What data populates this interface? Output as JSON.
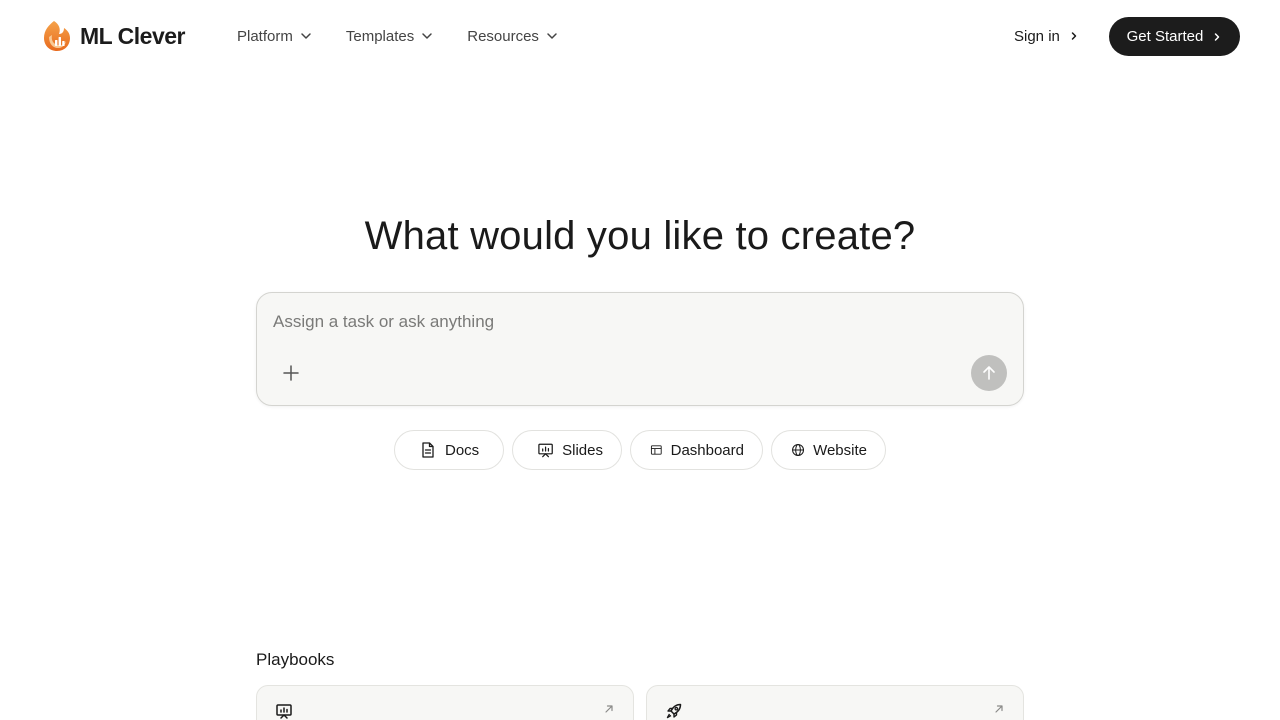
{
  "brand": {
    "name": "ML Clever",
    "logo_icon": "flame-chart-logo-icon",
    "accent": "#f08a2c"
  },
  "nav": {
    "items": [
      {
        "label": "Platform",
        "icon": "chevron-down-icon"
      },
      {
        "label": "Templates",
        "icon": "chevron-down-icon"
      },
      {
        "label": "Resources",
        "icon": "chevron-down-icon"
      }
    ],
    "sign_in_label": "Sign in",
    "get_started_label": "Get Started"
  },
  "hero": {
    "title": "What would you like to create?",
    "input_placeholder": "Assign a task or ask anything",
    "input_value": ""
  },
  "chips": [
    {
      "label": "Docs",
      "icon": "document-icon"
    },
    {
      "label": "Slides",
      "icon": "presentation-icon"
    },
    {
      "label": "Dashboard",
      "icon": "dashboard-icon"
    },
    {
      "label": "Website",
      "icon": "globe-icon"
    }
  ],
  "playbooks": {
    "title": "Playbooks",
    "cards": [
      {
        "icon": "presentation-icon"
      },
      {
        "icon": "rocket-icon"
      }
    ]
  },
  "colors": {
    "cta_bg": "#1c1c1c",
    "send_disabled": "#c0c0be",
    "composer_bg": "#f7f7f5"
  }
}
